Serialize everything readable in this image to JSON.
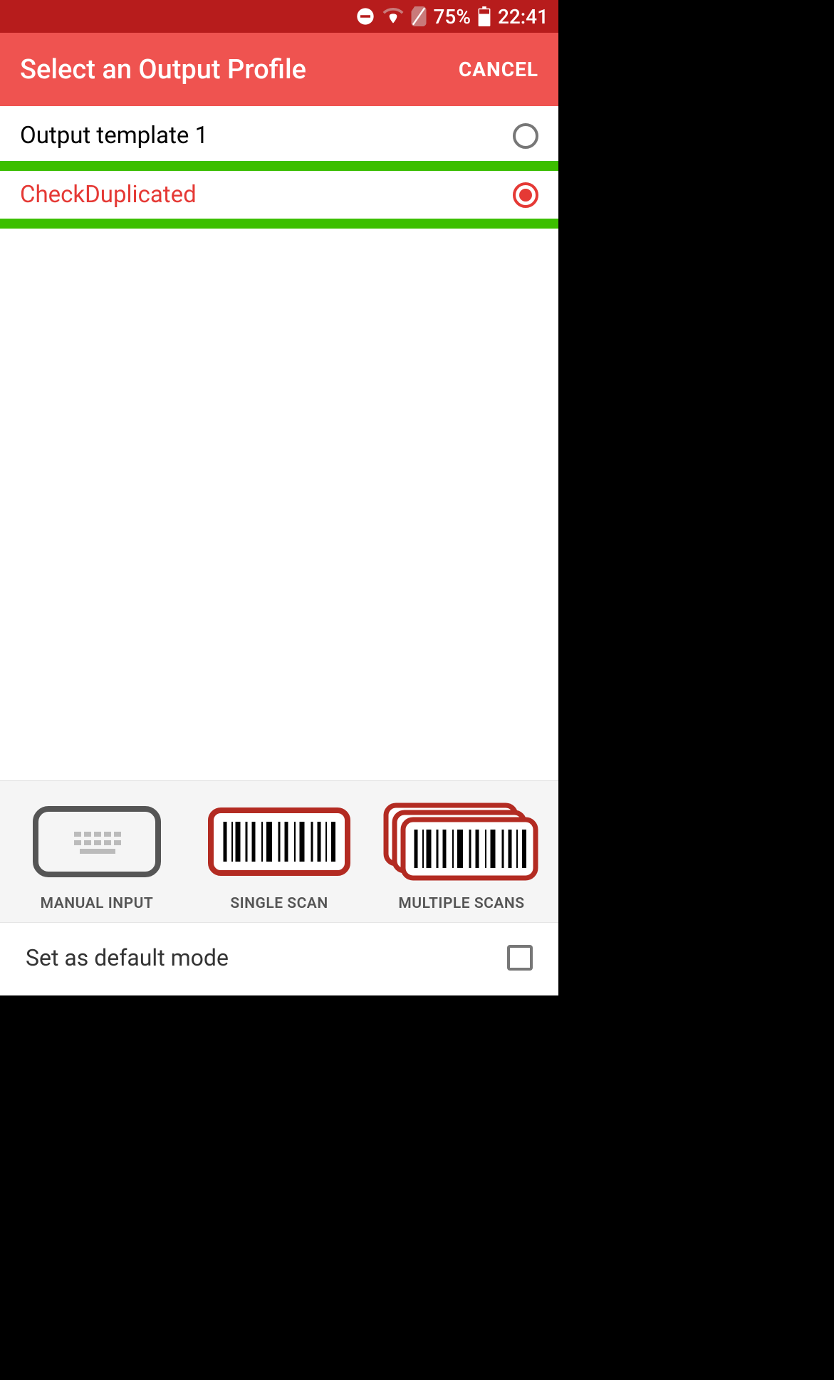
{
  "status_bar": {
    "battery_percent": "75%",
    "time": "22:41"
  },
  "app_bar": {
    "title": "Select an Output Profile",
    "cancel_label": "CANCEL"
  },
  "profiles": [
    {
      "label": "Output template 1",
      "selected": false
    },
    {
      "label": "CheckDuplicated",
      "selected": true,
      "highlighted": true
    }
  ],
  "modes": {
    "manual_input_label": "MANUAL INPUT",
    "single_scan_label": "SINGLE SCAN",
    "multiple_scans_label": "MULTIPLE SCANS"
  },
  "default_mode": {
    "label": "Set as default mode",
    "checked": false
  }
}
